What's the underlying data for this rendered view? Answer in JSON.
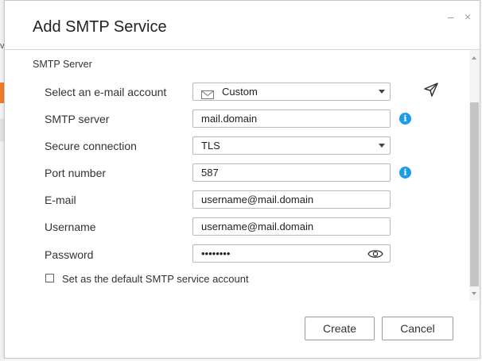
{
  "dialog": {
    "title": "Add SMTP Service",
    "minimize_glyph": "–",
    "close_glyph": "×"
  },
  "background": {
    "clipped_char": "v"
  },
  "section": {
    "label": "SMTP Server"
  },
  "fields": {
    "email_account": {
      "label": "Select an e-mail account",
      "value": "Custom",
      "icon": "mail-icon"
    },
    "smtp_server": {
      "label": "SMTP server",
      "value": "mail.domain"
    },
    "secure_connection": {
      "label": "Secure connection",
      "value": "TLS"
    },
    "port_number": {
      "label": "Port number",
      "value": "587"
    },
    "email": {
      "label": "E-mail",
      "value": "username@mail.domain"
    },
    "username": {
      "label": "Username",
      "value": "username@mail.domain"
    },
    "password": {
      "label": "Password",
      "value": "••••••••"
    }
  },
  "info_glyph": "i",
  "default_checkbox": {
    "label": "Set as the default SMTP service account",
    "checked": false
  },
  "buttons": {
    "create": "Create",
    "cancel": "Cancel"
  },
  "colors": {
    "accent_info": "#1e9be8",
    "background_accent": "#f07c2a"
  }
}
